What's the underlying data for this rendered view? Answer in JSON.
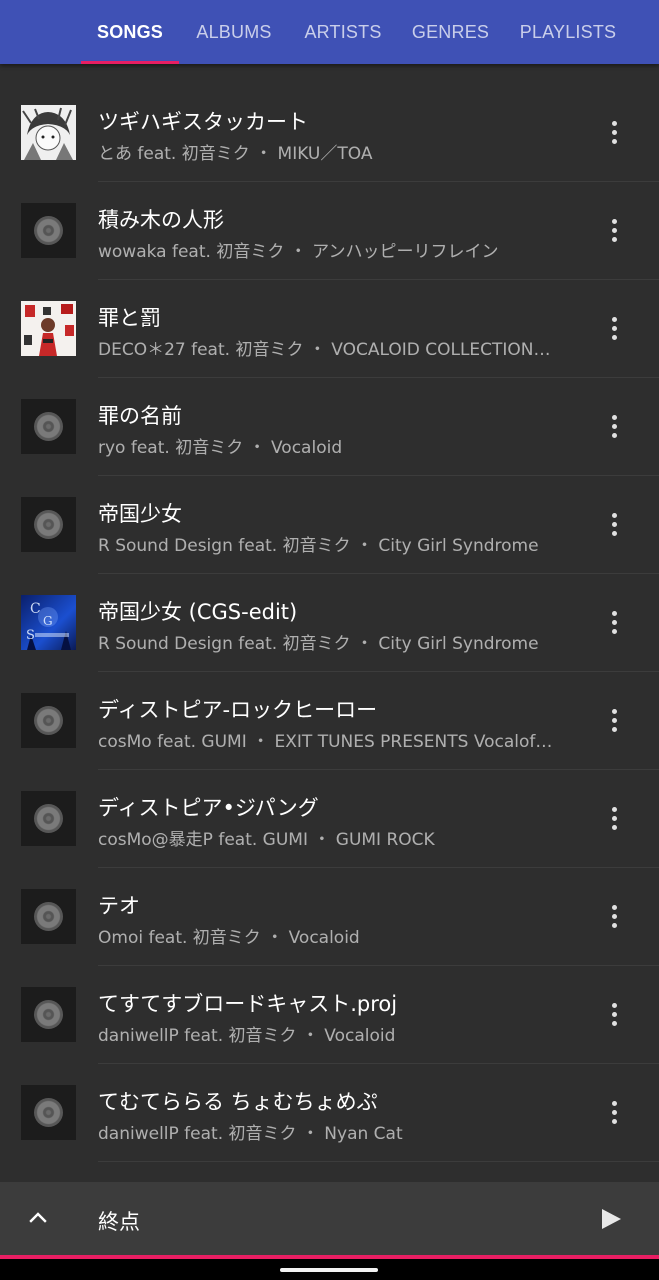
{
  "tabs": [
    "SONGS",
    "ALBUMS",
    "ARTISTS",
    "GENRES",
    "PLAYLISTS"
  ],
  "active_tab": "SONGS",
  "accent_color": "#e91e63",
  "header_color": "#3f51b5",
  "songs": [
    {
      "title": "ツギハギスタッカート",
      "subtitle": "とあ feat. 初音ミク ・ MIKU／TOA",
      "art": "album-art-manga"
    },
    {
      "title": "積み木の人形",
      "subtitle": "wowaka feat. 初音ミク ・ アンハッピーリフレイン",
      "art": "default-disc"
    },
    {
      "title": "罪と罰",
      "subtitle": "DECO＊27 feat. 初音ミク ・ VOCALOID COLLECTION…",
      "art": "album-art-decor"
    },
    {
      "title": "罪の名前",
      "subtitle": "ryo feat. 初音ミク ・ Vocaloid",
      "art": "default-disc"
    },
    {
      "title": "帝国少女",
      "subtitle": "R Sound Design feat. 初音ミク ・ City Girl Syndrome",
      "art": "default-disc"
    },
    {
      "title": "帝国少女 (CGS-edit)",
      "subtitle": "R Sound Design feat. 初音ミク ・ City Girl Syndrome",
      "art": "album-art-city-girl-syndrome"
    },
    {
      "title": "ディストピア-ロックヒーロー",
      "subtitle": "cosMo feat. GUMI ・ EXIT TUNES PRESENTS Vocalof…",
      "art": "default-disc"
    },
    {
      "title": "ディストピア•ジパング",
      "subtitle": "cosMo@暴走P feat. GUMI ・ GUMI ROCK",
      "art": "default-disc"
    },
    {
      "title": "テオ",
      "subtitle": "Omoi feat. 初音ミク ・ Vocaloid",
      "art": "default-disc"
    },
    {
      "title": "てすてすブロードキャスト.proj",
      "subtitle": "daniwellP feat. 初音ミク ・ Vocaloid",
      "art": "default-disc"
    },
    {
      "title": "てむてららる ちょむちょめぷ",
      "subtitle": "daniwellP feat. 初音ミク ・ Nyan Cat",
      "art": "default-disc"
    }
  ],
  "now_playing": {
    "title": "終点",
    "progress": 1.0,
    "expand_icon": "chevron-up-icon",
    "play_icon": "play-icon"
  }
}
